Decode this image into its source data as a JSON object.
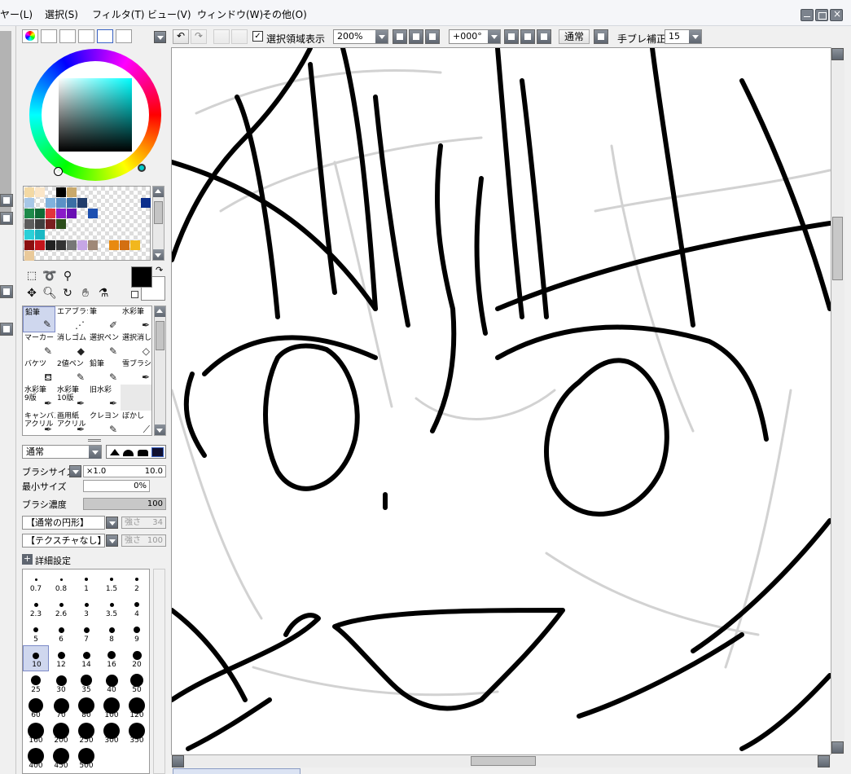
{
  "menu": [
    "ヤー(L)",
    "選択(S)",
    "フィルタ(T)",
    "ビュー(V)",
    "ウィンドウ(W)",
    "その他(O)"
  ],
  "toolbar": {
    "show_selection_label": "選択領域表示",
    "zoom": "200%",
    "rotation": "+000°",
    "blend_mode": "通常",
    "stabilizer_label": "手ブレ補正",
    "stabilizer_value": "15"
  },
  "brushes": [
    {
      "label": "鉛筆",
      "icon": "pencil-icon",
      "selected": true
    },
    {
      "label": "エアブラシ",
      "icon": "airbrush-icon"
    },
    {
      "label": "筆",
      "icon": "brush-icon"
    },
    {
      "label": "水彩筆",
      "icon": "watercolor-icon"
    },
    {
      "label": "マーカー",
      "icon": "marker-icon"
    },
    {
      "label": "消しゴム",
      "icon": "eraser-icon"
    },
    {
      "label": "選択ペン",
      "icon": "select-pen-icon"
    },
    {
      "label": "選択消し",
      "icon": "select-erase-icon"
    },
    {
      "label": "バケツ",
      "icon": "bucket-icon"
    },
    {
      "label": "2値ペン",
      "icon": "binary-pen-icon"
    },
    {
      "label": "鉛筆",
      "icon": "pencil-icon"
    },
    {
      "label": "雪ブラシ",
      "icon": "snow-brush-icon"
    },
    {
      "label": "水彩筆\n9版",
      "icon": "watercolor-icon"
    },
    {
      "label": "水彩筆\n10版",
      "icon": "watercolor-icon"
    },
    {
      "label": "旧水彩",
      "icon": "old-watercolor-icon"
    },
    {
      "label": "",
      "icon": ""
    },
    {
      "label": "キャンバス\nアクリル",
      "icon": "acrylic-icon"
    },
    {
      "label": "画用紙\nアクリル",
      "icon": "acrylic-icon"
    },
    {
      "label": "クレヨン",
      "icon": "crayon-icon"
    },
    {
      "label": "ぼかし",
      "icon": "blur-icon"
    }
  ],
  "brush_settings": {
    "blend_mode": "通常",
    "brush_size_label": "ブラシサイズ",
    "brush_size_multiplier": "×1.0",
    "brush_size_value": "10.0",
    "min_size_label": "最小サイズ",
    "min_size_value": "0%",
    "density_label": "ブラシ濃度",
    "density_value": "100",
    "density_fill": 1.0,
    "shape": "【通常の円形】",
    "shape_strength_label": "強さ",
    "shape_strength_value": "34",
    "texture": "【テクスチャなし】",
    "texture_strength_label": "強さ",
    "texture_strength_value": "100",
    "advanced_label": "詳細設定"
  },
  "sizes": [
    {
      "label": "0.7"
    },
    {
      "label": "0.8"
    },
    {
      "label": "1"
    },
    {
      "label": "1.5"
    },
    {
      "label": "2"
    },
    {
      "label": "2.3"
    },
    {
      "label": "2.6"
    },
    {
      "label": "3"
    },
    {
      "label": "3.5"
    },
    {
      "label": "4"
    },
    {
      "label": "5"
    },
    {
      "label": "6"
    },
    {
      "label": "7"
    },
    {
      "label": "8"
    },
    {
      "label": "9"
    },
    {
      "label": "10",
      "selected": true
    },
    {
      "label": "12"
    },
    {
      "label": "14"
    },
    {
      "label": "16"
    },
    {
      "label": "20"
    },
    {
      "label": "25"
    },
    {
      "label": "30"
    },
    {
      "label": "35"
    },
    {
      "label": "40"
    },
    {
      "label": "50"
    },
    {
      "label": "60"
    },
    {
      "label": "70"
    },
    {
      "label": "80"
    },
    {
      "label": "100"
    },
    {
      "label": "120"
    },
    {
      "label": "160"
    },
    {
      "label": "200"
    },
    {
      "label": "250"
    },
    {
      "label": "300"
    },
    {
      "label": "350"
    },
    {
      "label": "400"
    },
    {
      "label": "450"
    },
    {
      "label": "500"
    }
  ],
  "colors": {
    "foreground": "#000000",
    "background": "#ffffff",
    "swatches": [
      "#f3d9a4",
      "#fbe6c8",
      "#ffffff",
      "#000000",
      "#c9a96b",
      "#ffffff",
      "#ffffff",
      "#ffffff",
      "#ffffff",
      "#ffffff",
      "#ffffff",
      "#ffffff",
      "#a7c7e7",
      "#ffffff",
      "#7fb1dd",
      "#5b91c6",
      "#3a6fa5",
      "#203c6b",
      "#ffffff",
      "#ffffff",
      "#ffffff",
      "#ffffff",
      "#ffffff",
      "#0b2e8c",
      "#1d8a4a",
      "#0e6b36",
      "#e3323d",
      "#8a1bc9",
      "#6a0fb4",
      "#ffffff",
      "#1c4fb0",
      "#ffffff",
      "#ffffff",
      "#ffffff",
      "#ffffff",
      "#ffffff",
      "#5c5c5c",
      "#3f3f3f",
      "#7a1f1f",
      "#2b4d1b",
      "#ffffff",
      "#ffffff",
      "#ffffff",
      "#ffffff",
      "#ffffff",
      "#ffffff",
      "#ffffff",
      "#ffffff",
      "#2ad0d8",
      "#1ab8c4",
      "#ffffff",
      "#ffffff",
      "#ffffff",
      "#ffffff",
      "#ffffff",
      "#ffffff",
      "#ffffff",
      "#ffffff",
      "#ffffff",
      "#ffffff",
      "#8b0f0f",
      "#c4151c",
      "#222222",
      "#333333",
      "#777777",
      "#c6a6e6",
      "#9f8877",
      "#ffffff",
      "#e88a10",
      "#d36f12",
      "#f2b71d",
      "#ffffff",
      "#e9c99a",
      "#ffffff",
      "#ffffff",
      "#ffffff",
      "#ffffff",
      "#ffffff",
      "#ffffff",
      "#ffffff",
      "#ffffff",
      "#ffffff",
      "#ffffff",
      "#ffffff"
    ]
  }
}
